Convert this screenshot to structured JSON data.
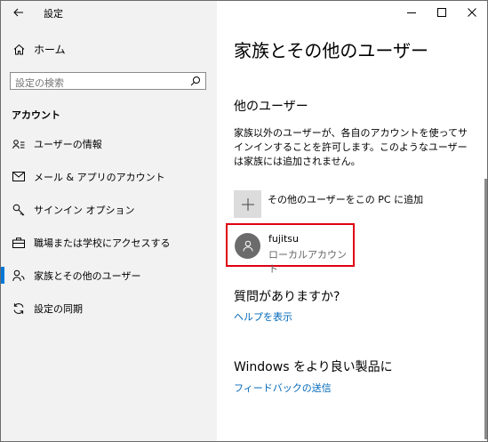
{
  "window": {
    "title": "設定"
  },
  "sidebar": {
    "home_label": "ホーム",
    "search_placeholder": "設定の検索",
    "section_title": "アカウント",
    "items": [
      {
        "label": "ユーザーの情報",
        "icon": "user-info-icon"
      },
      {
        "label": "メール & アプリのアカウント",
        "icon": "mail-icon"
      },
      {
        "label": "サインイン オプション",
        "icon": "key-icon"
      },
      {
        "label": "職場または学校にアクセスする",
        "icon": "briefcase-icon"
      },
      {
        "label": "家族とその他のユーザー",
        "icon": "family-icon",
        "active": true
      },
      {
        "label": "設定の同期",
        "icon": "sync-icon"
      }
    ]
  },
  "main": {
    "title": "家族とその他のユーザー",
    "other_users_heading": "他のユーザー",
    "description": "家族以外のユーザーが、各自のアカウントを使ってサインインすることを許可します。このようなユーザーは家族には追加されません。",
    "add_user_label": "その他のユーザーをこの PC に追加",
    "user": {
      "name": "fujitsu",
      "account_type": "ローカルアカウント"
    },
    "question_heading": "質問がありますか?",
    "help_link": "ヘルプを表示",
    "windows_heading": "Windows をより良い製品に",
    "feedback_link": "フィードバックの送信"
  },
  "colors": {
    "accent": "#0078d7",
    "link": "#0067b8",
    "highlight_border": "#e00012",
    "sidebar_bg": "#f2f2f2"
  }
}
